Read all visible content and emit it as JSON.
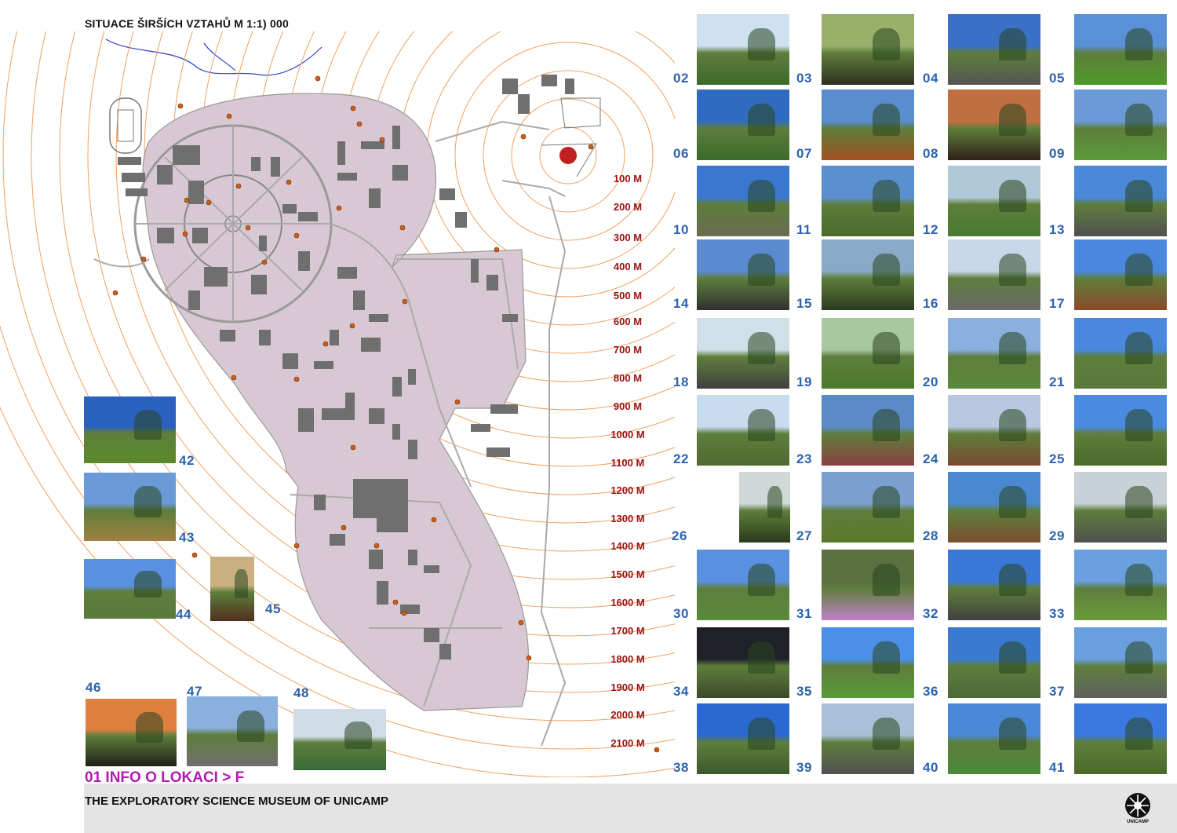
{
  "title": "SITUACE ŠIRŠÍCH VZTAHŮ  M 1:1) 000",
  "distances": [
    "100 M",
    "200 M",
    "300 M",
    "400 M",
    "500 M",
    "600 M",
    "700 M",
    "800 M",
    "900 M",
    "1000 M",
    "1100 M",
    "1200 M",
    "1300 M",
    "1400 M",
    "1500 M",
    "1600 M",
    "1700 M",
    "1800 M",
    "1900 M",
    "2000 M",
    "2100 M"
  ],
  "photos": [
    {
      "num": "02",
      "sky": "#cfe0f0",
      "ground": "#3d6a2a"
    },
    {
      "num": "03",
      "sky": "#9ab06a",
      "ground": "#2f2f20"
    },
    {
      "num": "04",
      "sky": "#3a70c8",
      "ground": "#555555"
    },
    {
      "num": "05",
      "sky": "#5a90d8",
      "ground": "#4f9a2a"
    },
    {
      "num": "06",
      "sky": "#2f6cc0",
      "ground": "#3a6a2a"
    },
    {
      "num": "07",
      "sky": "#5a8cd0",
      "ground": "#a05020"
    },
    {
      "num": "08",
      "sky": "#c07040",
      "ground": "#302018"
    },
    {
      "num": "09",
      "sky": "#6a9ad8",
      "ground": "#5a9a3a"
    },
    {
      "num": "10",
      "sky": "#3a78d0",
      "ground": "#6a6a50"
    },
    {
      "num": "11",
      "sky": "#5a90d0",
      "ground": "#4a6a2a"
    },
    {
      "num": "12",
      "sky": "#b0c8d8",
      "ground": "#4a7a30"
    },
    {
      "num": "13",
      "sky": "#4a88d8",
      "ground": "#505050"
    },
    {
      "num": "14",
      "sky": "#5a8ad0",
      "ground": "#303030"
    },
    {
      "num": "15",
      "sky": "#8aaac8",
      "ground": "#2a3a20"
    },
    {
      "num": "16",
      "sky": "#c8d8e8",
      "ground": "#6a6a6a"
    },
    {
      "num": "17",
      "sky": "#4a88e0",
      "ground": "#8a4a2a"
    },
    {
      "num": "18",
      "sky": "#d0e0e8",
      "ground": "#404040"
    },
    {
      "num": "19",
      "sky": "#a8c8a0",
      "ground": "#4a7a2a"
    },
    {
      "num": "20",
      "sky": "#8ab0e0",
      "ground": "#5a8a3a"
    },
    {
      "num": "21",
      "sky": "#4a88e0",
      "ground": "#5a7a3a"
    },
    {
      "num": "22",
      "sky": "#c8dcf0",
      "ground": "#506a30"
    },
    {
      "num": "23",
      "sky": "#5a8ac8",
      "ground": "#8a4040"
    },
    {
      "num": "24",
      "sky": "#b8c8e0",
      "ground": "#7a4a30"
    },
    {
      "num": "25",
      "sky": "#4a8ae0",
      "ground": "#4a6a2a"
    },
    {
      "num": "26",
      "sky": "#d0d8d8",
      "ground": "#2a3a1a"
    },
    {
      "num": "27",
      "sky": "#7aa0d0",
      "ground": "#5a7a2a"
    },
    {
      "num": "28",
      "sky": "#4a88d0",
      "ground": "#7a5030"
    },
    {
      "num": "29",
      "sky": "#c8d0d8",
      "ground": "#505050"
    },
    {
      "num": "30",
      "sky": "#5a90e0",
      "ground": "#5a8a3a"
    },
    {
      "num": "31",
      "sky": "#5a7040",
      "ground": "#c080c8"
    },
    {
      "num": "32",
      "sky": "#3a78d8",
      "ground": "#404040"
    },
    {
      "num": "33",
      "sky": "#6aa0e0",
      "ground": "#6a9a3a"
    },
    {
      "num": "34",
      "sky": "#202028",
      "ground": "#3a4a2a"
    },
    {
      "num": "35",
      "sky": "#4a90e8",
      "ground": "#5a9a3a"
    },
    {
      "num": "36",
      "sky": "#3a7ad0",
      "ground": "#4a6a3a"
    },
    {
      "num": "37",
      "sky": "#6aa0e0",
      "ground": "#606060"
    },
    {
      "num": "38",
      "sky": "#2a6ad0",
      "ground": "#3a5a2a"
    },
    {
      "num": "39",
      "sky": "#a8c0d8",
      "ground": "#505050"
    },
    {
      "num": "40",
      "sky": "#4a88d8",
      "ground": "#4a8a3a"
    },
    {
      "num": "41",
      "sky": "#3a7ae0",
      "ground": "#4a6a2a"
    },
    {
      "num": "42",
      "sky": "#2a60c0",
      "ground": "#5a8a2a"
    },
    {
      "num": "43",
      "sky": "#6a9ad8",
      "ground": "#a08040"
    },
    {
      "num": "44",
      "sky": "#5a90e0",
      "ground": "#5a7a3a"
    },
    {
      "num": "45",
      "sky": "#c8b080",
      "ground": "#503020"
    },
    {
      "num": "46",
      "sky": "#e08040",
      "ground": "#202018"
    },
    {
      "num": "47",
      "sky": "#8ab0e0",
      "ground": "#707070"
    },
    {
      "num": "48",
      "sky": "#d0dce8",
      "ground": "#3a6a3a"
    }
  ],
  "footer": {
    "info": "01 INFO O LOKACI  > F",
    "museum": "THE EXPLORATORY SCIENCE MUSEUM OF UNICAMP",
    "logo_text": "UNICAMP"
  },
  "colors": {
    "campus_fill": "#d8c8d4",
    "ring": "#f2a060",
    "distance_label": "#a01010",
    "photo_number": "#2b63b0",
    "marker": "#c02020",
    "info": "#b21bb3"
  }
}
